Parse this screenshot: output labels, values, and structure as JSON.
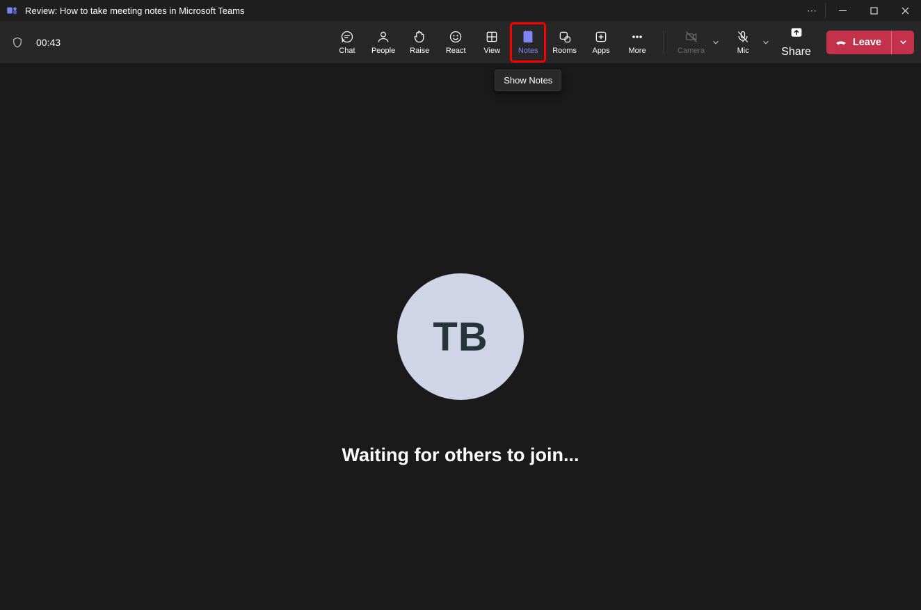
{
  "titlebar": {
    "title": "Review: How to take meeting notes in Microsoft Teams"
  },
  "toolbar": {
    "timer": "00:43",
    "items": {
      "chat": "Chat",
      "people": "People",
      "raise": "Raise",
      "react": "React",
      "view": "View",
      "notes": "Notes",
      "rooms": "Rooms",
      "apps": "Apps",
      "more": "More",
      "camera": "Camera",
      "mic": "Mic",
      "share": "Share",
      "leave": "Leave"
    }
  },
  "tooltip": {
    "notes": "Show Notes"
  },
  "main": {
    "avatar_initials": "TB",
    "waiting_message": "Waiting for others to join..."
  },
  "colors": {
    "accent_active": "#7f85f5",
    "leave_bg": "#c4314b",
    "avatar_bg": "#cfd4e6",
    "highlight": "#ff0000"
  }
}
